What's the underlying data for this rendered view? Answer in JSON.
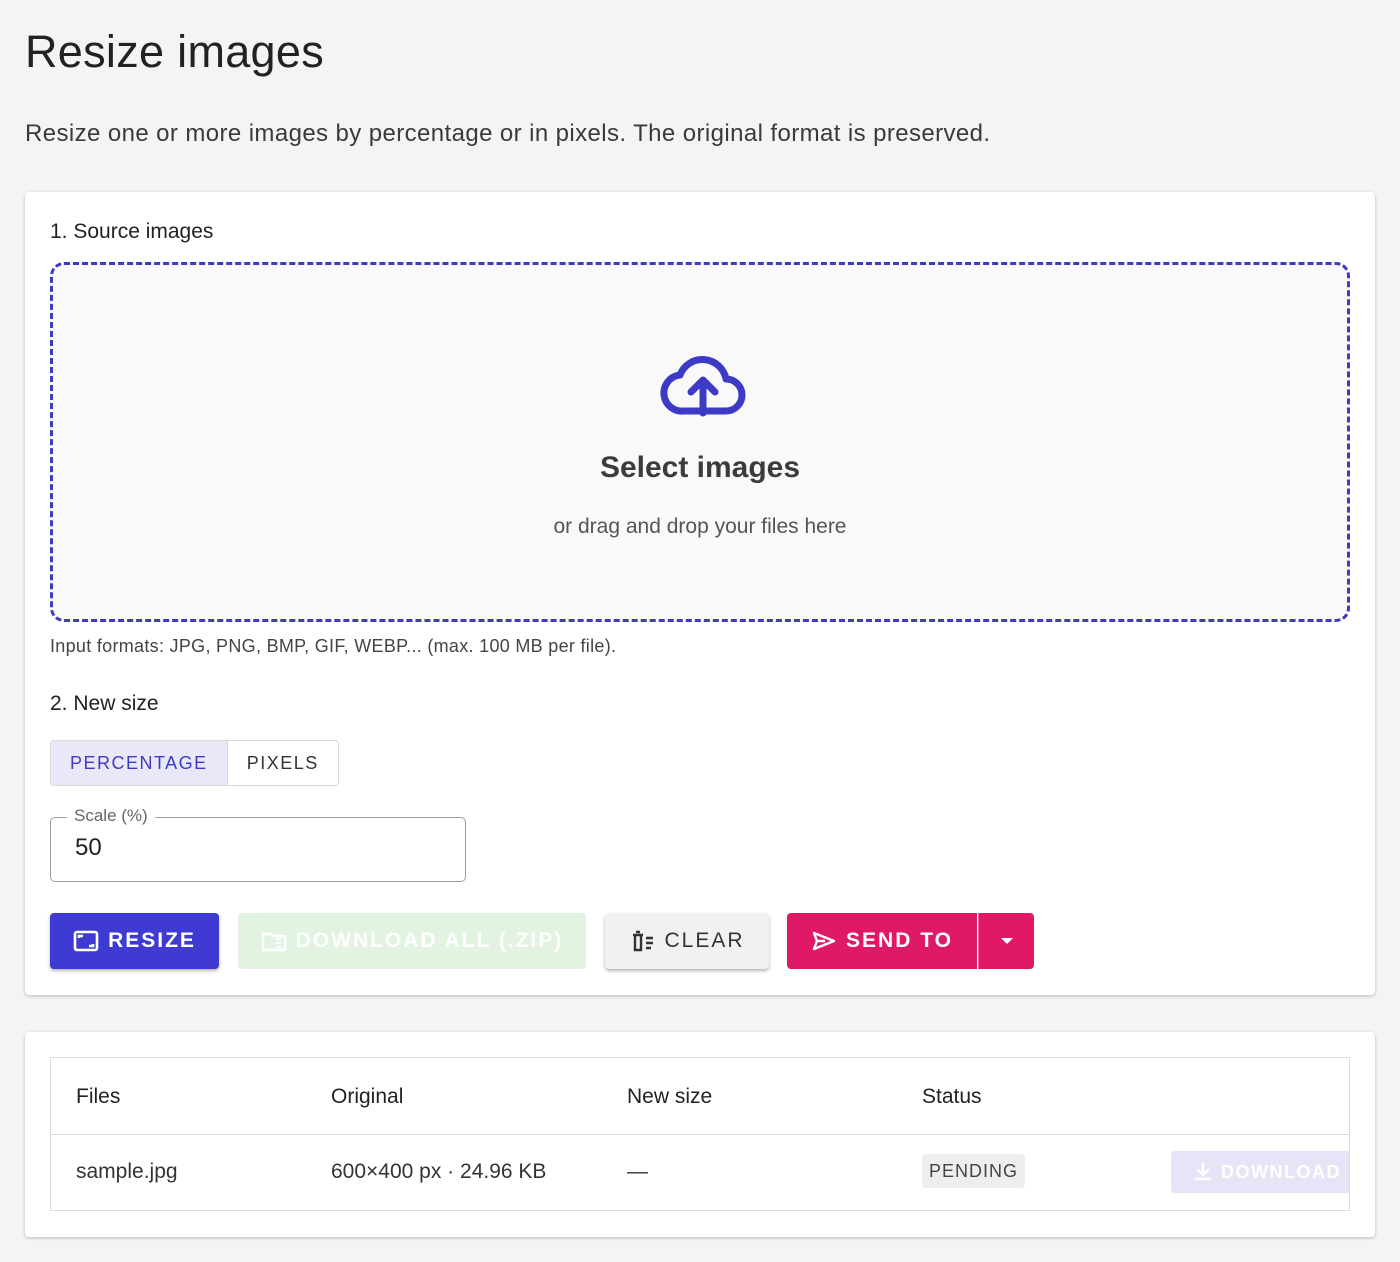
{
  "page": {
    "title": "Resize images",
    "description": "Resize one or more images by percentage or in pixels. The original format is preserved."
  },
  "source": {
    "section_title": "1. Source images",
    "dropzone_title": "Select images",
    "dropzone_subtitle": "or drag and drop your files here",
    "hint": "Input formats: JPG, PNG, BMP, GIF, WEBP... (max. 100 MB per file).",
    "icon": "cloud-upload-icon"
  },
  "size": {
    "section_title": "2. New size",
    "modes": [
      "PERCENTAGE",
      "PIXELS"
    ],
    "active_mode": "PERCENTAGE",
    "scale_label": "Scale (%)",
    "scale_value": "50"
  },
  "actions": {
    "resize": "RESIZE",
    "download_all": "DOWNLOAD ALL (.ZIP)",
    "clear": "CLEAR",
    "send_to": "SEND TO"
  },
  "table": {
    "columns": [
      "Files",
      "Original",
      "New size",
      "Status"
    ],
    "rows": [
      {
        "file": "sample.jpg",
        "original": "600×400 px · 24.96 KB",
        "new_size": "—",
        "status": "PENDING",
        "download": "DOWNLOAD"
      }
    ]
  },
  "colors": {
    "accent": "#3f3bd2",
    "send": "#e01967",
    "download_disabled": "#e2f3e2",
    "background": "#f4f4f4"
  }
}
